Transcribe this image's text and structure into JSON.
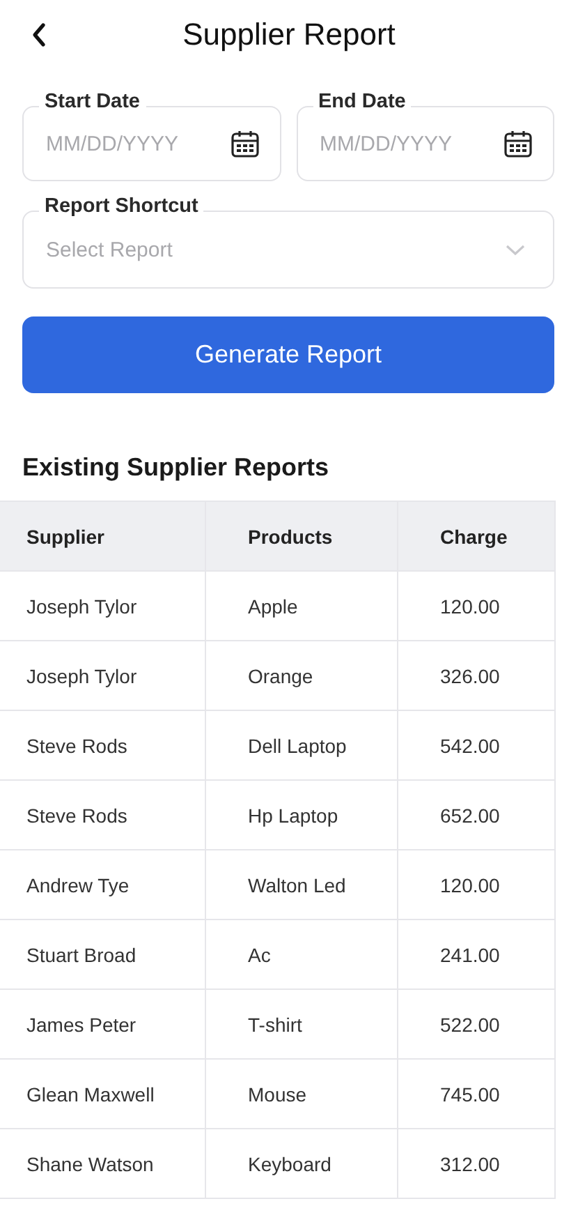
{
  "header": {
    "title": "Supplier Report"
  },
  "date_fields": [
    {
      "label": "Start Date",
      "placeholder": "MM/DD/YYYY"
    },
    {
      "label": "End Date",
      "placeholder": "MM/DD/YYYY"
    }
  ],
  "report_shortcut": {
    "label": "Report Shortcut",
    "placeholder": "Select Report"
  },
  "generate_button": "Generate Report",
  "section_title": "Existing Supplier Reports",
  "table": {
    "columns": [
      "Supplier",
      "Products",
      "Charge"
    ],
    "rows": [
      [
        "Joseph Tylor",
        "Apple",
        "120.00"
      ],
      [
        "Joseph Tylor",
        "Orange",
        "326.00"
      ],
      [
        "Steve Rods",
        "Dell Laptop",
        "542.00"
      ],
      [
        "Steve Rods",
        "Hp Laptop",
        "652.00"
      ],
      [
        "Andrew Tye",
        "Walton Led",
        "120.00"
      ],
      [
        "Stuart Broad",
        "Ac",
        "241.00"
      ],
      [
        "James Peter",
        "T-shirt",
        "522.00"
      ],
      [
        "Glean Maxwell",
        "Mouse",
        "745.00"
      ],
      [
        "Shane Watson",
        "Keyboard",
        "312.00"
      ]
    ]
  }
}
